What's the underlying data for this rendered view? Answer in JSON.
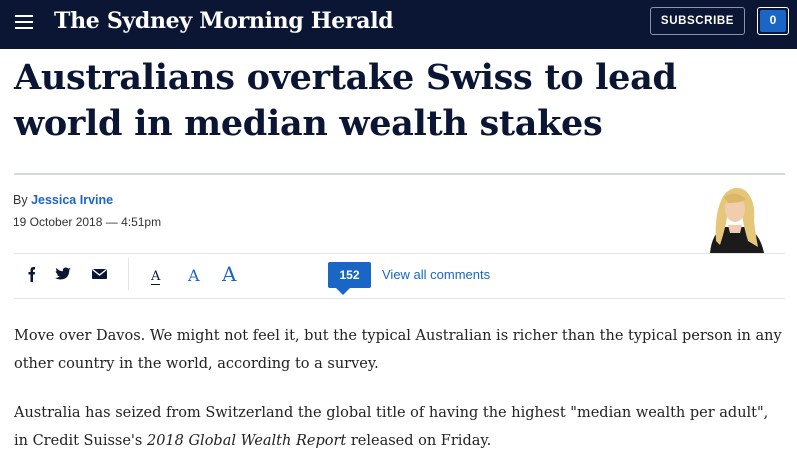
{
  "header": {
    "masthead": "The Sydney Morning Herald",
    "subscribe_label": "SUBSCRIBE",
    "account_count": "0"
  },
  "article": {
    "headline": "Australians overtake Swiss to lead world in median wealth stakes",
    "byline_prefix": "By",
    "author": "Jessica Irvine",
    "date": "19 October 2018 — 4:51pm",
    "paragraph1": "Move over Davos. We might not feel it, but the typical Australian is richer than the typical person in any other country in the world, according to a survey.",
    "paragraph2_before": "Australia has seized from Switzerland the global title of having the highest \"median wealth per adult\", in Credit Suisse's ",
    "paragraph2_em": "2018 Global Wealth Report",
    "paragraph2_after": " released on Friday."
  },
  "tools": {
    "font_small": "A",
    "font_medium": "A",
    "font_large": "A",
    "comment_count": "152",
    "comments_link": "View all comments"
  },
  "icons": {
    "menu": "hamburger-icon",
    "facebook": "facebook-icon",
    "twitter": "twitter-icon",
    "email": "email-icon"
  },
  "colors": {
    "brand_navy": "#0a1633",
    "accent_blue": "#1a66c6"
  }
}
